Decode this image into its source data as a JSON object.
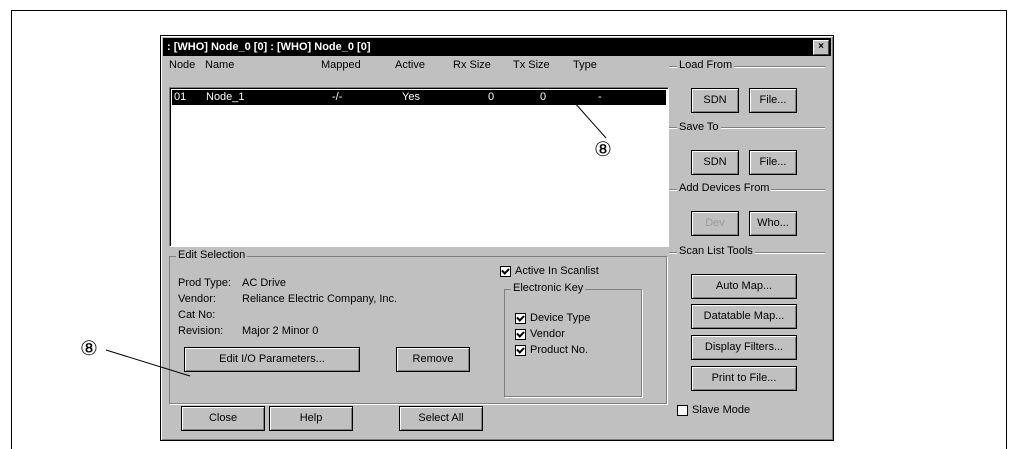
{
  "window": {
    "title": ": [WHO] Node_0 [0] : [WHO] Node_0 [0]",
    "close_label": "×"
  },
  "list": {
    "headers": [
      "Node",
      "Name",
      "Mapped",
      "Active",
      "Rx Size",
      "Tx Size",
      "Type"
    ],
    "rows": [
      {
        "node": "01",
        "name": "Node_1",
        "mapped": "-/-",
        "active": "Yes",
        "rx": "0",
        "tx": "0",
        "type": "-"
      }
    ]
  },
  "side": {
    "load_from": {
      "title": "Load From",
      "buttons": [
        "SDN",
        "File..."
      ]
    },
    "save_to": {
      "title": "Save To",
      "buttons": [
        "SDN",
        "File..."
      ]
    },
    "add_devices": {
      "title": "Add Devices From",
      "buttons": [
        "Dev",
        "Who..."
      ]
    },
    "scan_tools": {
      "title": "Scan List Tools",
      "buttons": [
        "Auto Map...",
        "Datatable Map...",
        "Display Filters...",
        "Print to File..."
      ]
    },
    "slave_mode": {
      "label": "Slave Mode",
      "checked": false
    }
  },
  "edit_selection": {
    "title": "Edit Selection",
    "fields": [
      {
        "label": "Prod Type:",
        "value": "AC Drive"
      },
      {
        "label": "Vendor:",
        "value": "Reliance Electric Company, Inc."
      },
      {
        "label": "Cat No:",
        "value": ""
      },
      {
        "label": "Revision:",
        "value": "Major 2 Minor 0"
      }
    ],
    "active_in_scanlist": {
      "label": "Active In Scanlist",
      "checked": true
    },
    "electronic_key": {
      "title": "Electronic Key",
      "items": [
        {
          "label": "Device Type",
          "checked": true
        },
        {
          "label": "Vendor",
          "checked": true
        },
        {
          "label": "Product No.",
          "checked": true
        }
      ]
    },
    "edit_io_button": "Edit I/O Parameters...",
    "remove_button": "Remove"
  },
  "bottom": {
    "close": "Close",
    "help": "Help",
    "select_all": "Select All"
  },
  "callouts": {
    "top": "⑧",
    "left": "⑧"
  }
}
